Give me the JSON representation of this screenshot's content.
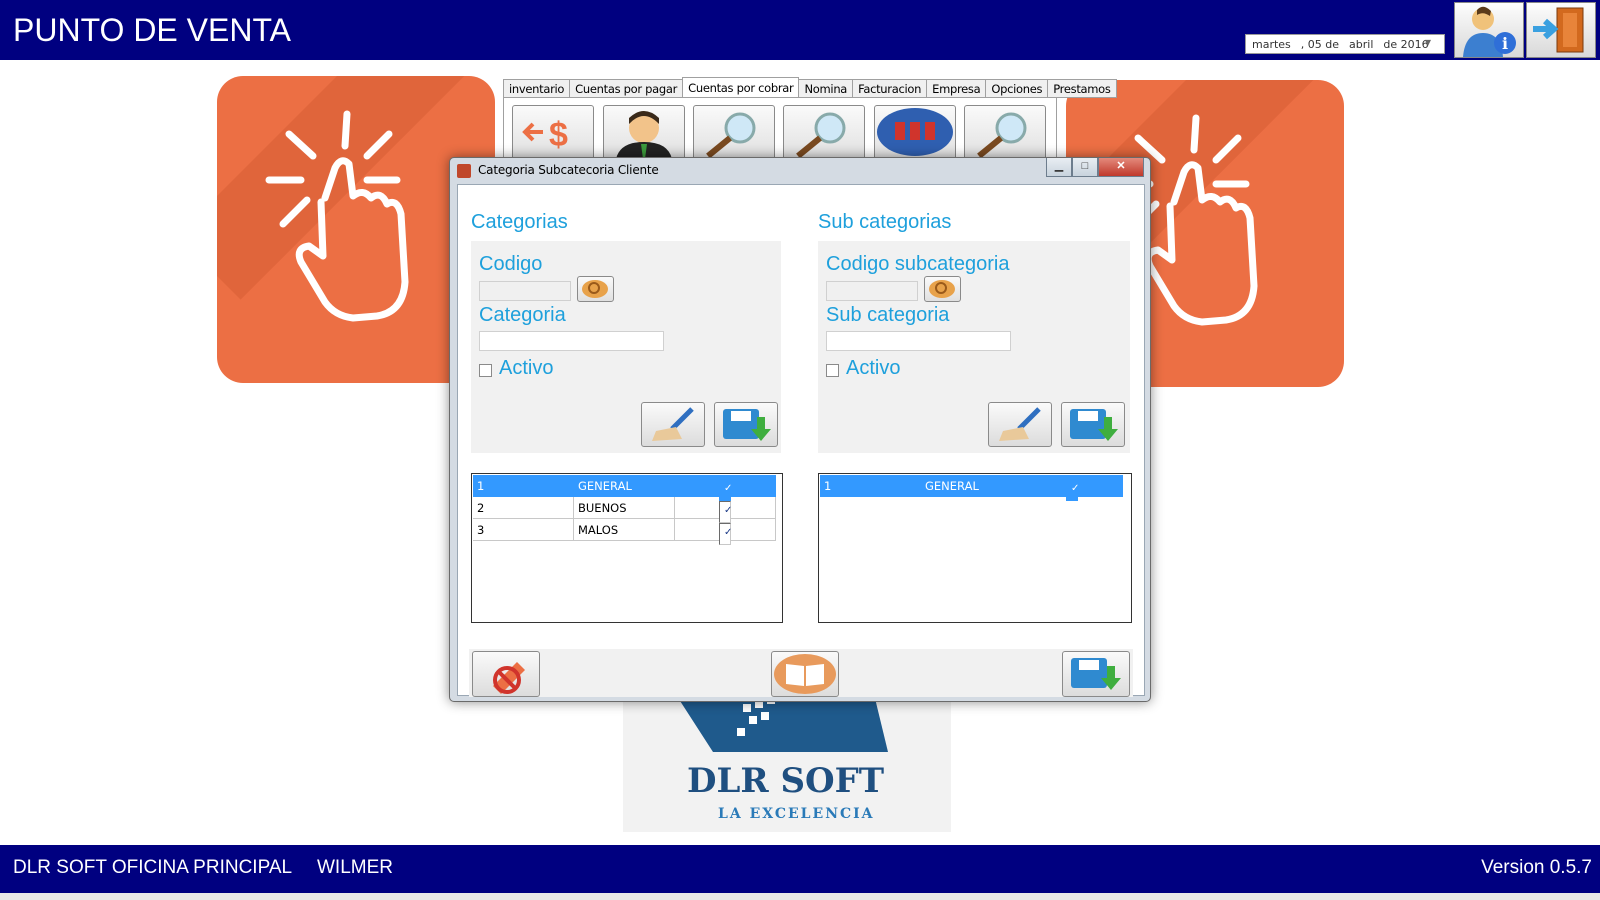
{
  "app": {
    "title": "PUNTO DE VENTA"
  },
  "date": {
    "day": "martes",
    "num": ", 05 de",
    "month": "abril",
    "year": "de 2016"
  },
  "tabs": [
    "inventario",
    "Cuentas por pagar",
    "Cuentas por cobrar",
    "Nomina",
    "Facturacion",
    "Empresa",
    "Opciones",
    "Prestamos"
  ],
  "dialog": {
    "title": "Categoria Subcatecoria Cliente",
    "left": {
      "heading": "Categorias",
      "code_label": "Codigo",
      "name_label": "Categoria",
      "active_label": "Activo",
      "rows": [
        {
          "id": "1",
          "name": "GENERAL",
          "checked": "✓"
        },
        {
          "id": "2",
          "name": "BUENOS",
          "checked": "✓"
        },
        {
          "id": "3",
          "name": "MALOS",
          "checked": "✓"
        }
      ]
    },
    "right": {
      "heading": "Sub categorias",
      "code_label": "Codigo subcategoria",
      "name_label": "Sub categoria",
      "active_label": "Activo",
      "rows": [
        {
          "id": "1",
          "name": "GENERAL",
          "checked": "✓"
        }
      ]
    }
  },
  "logo": {
    "name": "DLR SOFT",
    "tagline": "LA EXCELENCIA"
  },
  "status": {
    "office": "DLR SOFT OFICINA PRINCIPAL",
    "user": "WILMER",
    "version": "Version 0.5.7"
  },
  "colors": {
    "header": "#000080",
    "accent_orange": "#ec6f44",
    "label_blue": "#1ea0dc",
    "selection": "#3399ff"
  }
}
